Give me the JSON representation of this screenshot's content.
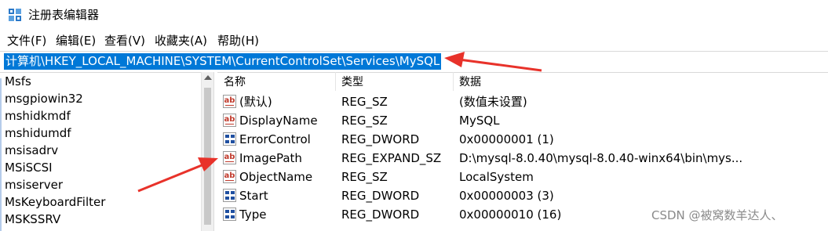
{
  "window": {
    "title": "注册表编辑器"
  },
  "menu": [
    {
      "label": "文件(F)"
    },
    {
      "label": "编辑(E)"
    },
    {
      "label": "查看(V)"
    },
    {
      "label": "收藏夹(A)"
    },
    {
      "label": "帮助(H)"
    }
  ],
  "address": {
    "path": "计算机\\HKEY_LOCAL_MACHINE\\SYSTEM\\CurrentControlSet\\Services\\MySQL"
  },
  "tree": {
    "items": [
      {
        "label": "Msfs"
      },
      {
        "label": "msgpiowin32"
      },
      {
        "label": "mshidkmdf"
      },
      {
        "label": "mshidumdf"
      },
      {
        "label": "msisadrv"
      },
      {
        "label": "MSiSCSI"
      },
      {
        "label": "msiserver"
      },
      {
        "label": "MsKeyboardFilter"
      },
      {
        "label": "MSKSSRV"
      }
    ]
  },
  "list": {
    "headers": {
      "name": "名称",
      "type": "类型",
      "data": "数据"
    },
    "rows": [
      {
        "icon": "string-value-icon",
        "name": "(默认)",
        "type": "REG_SZ",
        "data": "(数值未设置)"
      },
      {
        "icon": "string-value-icon",
        "name": "DisplayName",
        "type": "REG_SZ",
        "data": "MySQL"
      },
      {
        "icon": "binary-value-icon",
        "name": "ErrorControl",
        "type": "REG_DWORD",
        "data": "0x00000001 (1)"
      },
      {
        "icon": "string-value-icon",
        "name": "ImagePath",
        "type": "REG_EXPAND_SZ",
        "data": "D:\\mysql-8.0.40\\mysql-8.0.40-winx64\\bin\\mys..."
      },
      {
        "icon": "string-value-icon",
        "name": "ObjectName",
        "type": "REG_SZ",
        "data": "LocalSystem"
      },
      {
        "icon": "binary-value-icon",
        "name": "Start",
        "type": "REG_DWORD",
        "data": "0x00000003 (3)"
      },
      {
        "icon": "binary-value-icon",
        "name": "Type",
        "type": "REG_DWORD",
        "data": "0x00000010 (16)"
      }
    ]
  },
  "watermark": "CSDN @被窝数羊达人、",
  "colors": {
    "selection": "#0078d7",
    "annotation_arrow": "#e8322a"
  }
}
